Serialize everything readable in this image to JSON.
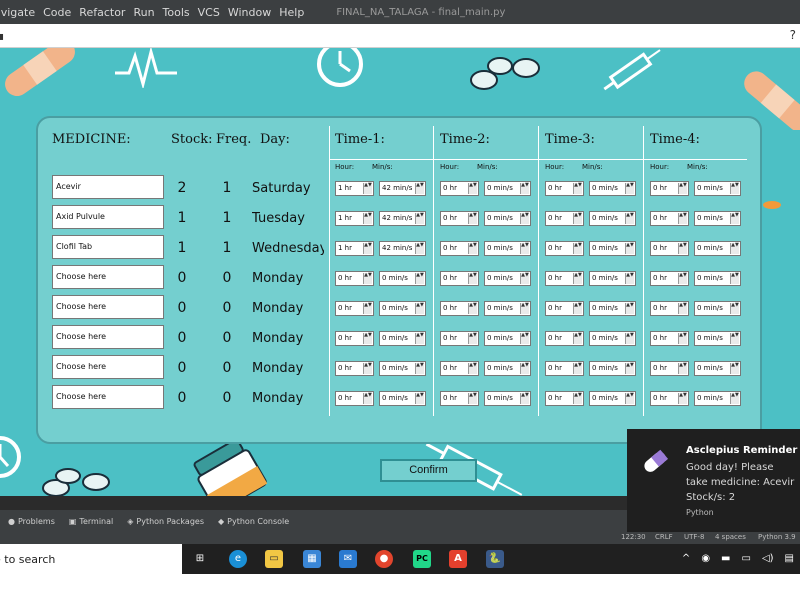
{
  "ide": {
    "menu": [
      "avigate",
      "Code",
      "Refactor",
      "Run",
      "Tools",
      "VCS",
      "Window",
      "Help"
    ],
    "title": "FINAL_NA_TALAGA - final_main.py",
    "help_glyph": "?",
    "tool_tabs": [
      "Problems",
      "Terminal",
      "Python Packages",
      "Python Console"
    ],
    "status": {
      "position": "122:30",
      "line_sep": "CRLF",
      "encoding": "UTF-8",
      "indent": "4 spaces",
      "interpreter": "Python 3.9"
    }
  },
  "app": {
    "headers": {
      "medicine": "MEDICINE:",
      "stock": "Stock:",
      "freq": "Freq.",
      "day": "Day:"
    },
    "time_headers": [
      "Time-1:",
      "Time-2:",
      "Time-3:",
      "Time-4:"
    ],
    "sub_hour": "Hour:",
    "sub_min": "Min/s:",
    "rows": [
      {
        "medicine": "Acevir",
        "stock": "2",
        "freq": "1",
        "day": "Saturday",
        "times": [
          [
            "1 hr",
            "42 min/s"
          ],
          [
            "0 hr",
            "0 min/s"
          ],
          [
            "0 hr",
            "0 min/s"
          ],
          [
            "0 hr",
            "0 min/s"
          ]
        ]
      },
      {
        "medicine": "Axid Pulvule",
        "stock": "1",
        "freq": "1",
        "day": "Tuesday",
        "times": [
          [
            "1 hr",
            "42 min/s"
          ],
          [
            "0 hr",
            "0 min/s"
          ],
          [
            "0 hr",
            "0 min/s"
          ],
          [
            "0 hr",
            "0 min/s"
          ]
        ]
      },
      {
        "medicine": "Clofil Tab",
        "stock": "1",
        "freq": "1",
        "day": "Wednesday",
        "times": [
          [
            "1 hr",
            "42 min/s"
          ],
          [
            "0 hr",
            "0 min/s"
          ],
          [
            "0 hr",
            "0 min/s"
          ],
          [
            "0 hr",
            "0 min/s"
          ]
        ]
      },
      {
        "medicine": "Choose here",
        "stock": "0",
        "freq": "0",
        "day": "Monday",
        "times": [
          [
            "0 hr",
            "0 min/s"
          ],
          [
            "0 hr",
            "0 min/s"
          ],
          [
            "0 hr",
            "0 min/s"
          ],
          [
            "0 hr",
            "0 min/s"
          ]
        ]
      },
      {
        "medicine": "Choose here",
        "stock": "0",
        "freq": "0",
        "day": "Monday",
        "times": [
          [
            "0 hr",
            "0 min/s"
          ],
          [
            "0 hr",
            "0 min/s"
          ],
          [
            "0 hr",
            "0 min/s"
          ],
          [
            "0 hr",
            "0 min/s"
          ]
        ]
      },
      {
        "medicine": "Choose here",
        "stock": "0",
        "freq": "0",
        "day": "Monday",
        "times": [
          [
            "0 hr",
            "0 min/s"
          ],
          [
            "0 hr",
            "0 min/s"
          ],
          [
            "0 hr",
            "0 min/s"
          ],
          [
            "0 hr",
            "0 min/s"
          ]
        ]
      },
      {
        "medicine": "Choose here",
        "stock": "0",
        "freq": "0",
        "day": "Monday",
        "times": [
          [
            "0 hr",
            "0 min/s"
          ],
          [
            "0 hr",
            "0 min/s"
          ],
          [
            "0 hr",
            "0 min/s"
          ],
          [
            "0 hr",
            "0 min/s"
          ]
        ]
      },
      {
        "medicine": "Choose here",
        "stock": "0",
        "freq": "0",
        "day": "Monday",
        "times": [
          [
            "0 hr",
            "0 min/s"
          ],
          [
            "0 hr",
            "0 min/s"
          ],
          [
            "0 hr",
            "0 min/s"
          ],
          [
            "0 hr",
            "0 min/s"
          ]
        ]
      }
    ],
    "confirm_label": "Confirm"
  },
  "notification": {
    "title": "Asclepius Reminder",
    "body": "Good day! Please take medicine: Acevir Stock/s: 2",
    "source": "Python"
  },
  "taskbar": {
    "search_text": "e to search"
  },
  "colors": {
    "app_bg": "#4cc0c5",
    "panel_bg": "#74cfcf",
    "panel_border": "#4a9ea2"
  }
}
